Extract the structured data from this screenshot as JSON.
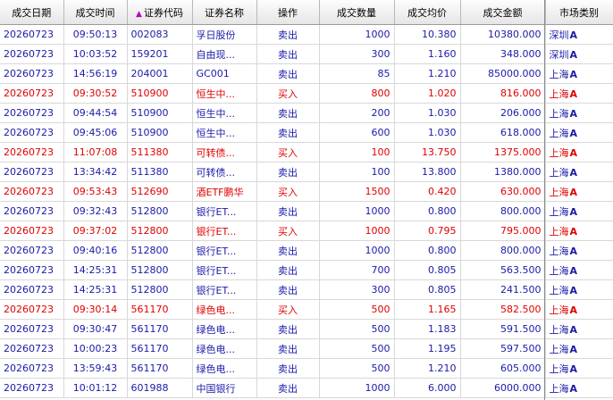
{
  "columns": [
    "成交日期",
    "成交时间",
    "证券代码",
    "证券名称",
    "操作",
    "成交数量",
    "成交均价",
    "成交金额",
    "市场类别"
  ],
  "sorted_column": "证券代码",
  "colors": {
    "sell": "#1a1aa8",
    "buy": "#e00000",
    "sort_arrow": "#c000c0"
  },
  "rows": [
    {
      "date": "20260723",
      "time": "09:50:13",
      "code": "002083",
      "name": "孚日股份",
      "op": "卖出",
      "qty": "1000",
      "price": "10.380",
      "amount": "10380.000",
      "market": "深圳",
      "mark": "A",
      "type": "sell"
    },
    {
      "date": "20260723",
      "time": "10:03:52",
      "code": "159201",
      "name": "自由现...",
      "op": "卖出",
      "qty": "300",
      "price": "1.160",
      "amount": "348.000",
      "market": "深圳",
      "mark": "A",
      "type": "sell"
    },
    {
      "date": "20260723",
      "time": "14:56:19",
      "code": "204001",
      "name": "GC001",
      "op": "卖出",
      "qty": "85",
      "price": "1.210",
      "amount": "85000.000",
      "market": "上海",
      "mark": "A",
      "type": "sell"
    },
    {
      "date": "20260723",
      "time": "09:30:52",
      "code": "510900",
      "name": "恒生中...",
      "op": "买入",
      "qty": "800",
      "price": "1.020",
      "amount": "816.000",
      "market": "上海",
      "mark": "A",
      "type": "buy"
    },
    {
      "date": "20260723",
      "time": "09:44:54",
      "code": "510900",
      "name": "恒生中...",
      "op": "卖出",
      "qty": "200",
      "price": "1.030",
      "amount": "206.000",
      "market": "上海",
      "mark": "A",
      "type": "sell"
    },
    {
      "date": "20260723",
      "time": "09:45:06",
      "code": "510900",
      "name": "恒生中...",
      "op": "卖出",
      "qty": "600",
      "price": "1.030",
      "amount": "618.000",
      "market": "上海",
      "mark": "A",
      "type": "sell"
    },
    {
      "date": "20260723",
      "time": "11:07:08",
      "code": "511380",
      "name": "可转债...",
      "op": "买入",
      "qty": "100",
      "price": "13.750",
      "amount": "1375.000",
      "market": "上海",
      "mark": "A",
      "type": "buy"
    },
    {
      "date": "20260723",
      "time": "13:34:42",
      "code": "511380",
      "name": "可转债...",
      "op": "卖出",
      "qty": "100",
      "price": "13.800",
      "amount": "1380.000",
      "market": "上海",
      "mark": "A",
      "type": "sell"
    },
    {
      "date": "20260723",
      "time": "09:53:43",
      "code": "512690",
      "name": "酒ETF鹏华",
      "op": "买入",
      "qty": "1500",
      "price": "0.420",
      "amount": "630.000",
      "market": "上海",
      "mark": "A",
      "type": "buy"
    },
    {
      "date": "20260723",
      "time": "09:32:43",
      "code": "512800",
      "name": "银行ET...",
      "op": "卖出",
      "qty": "1000",
      "price": "0.800",
      "amount": "800.000",
      "market": "上海",
      "mark": "A",
      "type": "sell"
    },
    {
      "date": "20260723",
      "time": "09:37:02",
      "code": "512800",
      "name": "银行ET...",
      "op": "买入",
      "qty": "1000",
      "price": "0.795",
      "amount": "795.000",
      "market": "上海",
      "mark": "A",
      "type": "buy"
    },
    {
      "date": "20260723",
      "time": "09:40:16",
      "code": "512800",
      "name": "银行ET...",
      "op": "卖出",
      "qty": "1000",
      "price": "0.800",
      "amount": "800.000",
      "market": "上海",
      "mark": "A",
      "type": "sell"
    },
    {
      "date": "20260723",
      "time": "14:25:31",
      "code": "512800",
      "name": "银行ET...",
      "op": "卖出",
      "qty": "700",
      "price": "0.805",
      "amount": "563.500",
      "market": "上海",
      "mark": "A",
      "type": "sell"
    },
    {
      "date": "20260723",
      "time": "14:25:31",
      "code": "512800",
      "name": "银行ET...",
      "op": "卖出",
      "qty": "300",
      "price": "0.805",
      "amount": "241.500",
      "market": "上海",
      "mark": "A",
      "type": "sell"
    },
    {
      "date": "20260723",
      "time": "09:30:14",
      "code": "561170",
      "name": "绿色电...",
      "op": "买入",
      "qty": "500",
      "price": "1.165",
      "amount": "582.500",
      "market": "上海",
      "mark": "A",
      "type": "buy"
    },
    {
      "date": "20260723",
      "time": "09:30:47",
      "code": "561170",
      "name": "绿色电...",
      "op": "卖出",
      "qty": "500",
      "price": "1.183",
      "amount": "591.500",
      "market": "上海",
      "mark": "A",
      "type": "sell"
    },
    {
      "date": "20260723",
      "time": "10:00:23",
      "code": "561170",
      "name": "绿色电...",
      "op": "卖出",
      "qty": "500",
      "price": "1.195",
      "amount": "597.500",
      "market": "上海",
      "mark": "A",
      "type": "sell"
    },
    {
      "date": "20260723",
      "time": "13:59:43",
      "code": "561170",
      "name": "绿色电...",
      "op": "卖出",
      "qty": "500",
      "price": "1.210",
      "amount": "605.000",
      "market": "上海",
      "mark": "A",
      "type": "sell"
    },
    {
      "date": "20260723",
      "time": "10:01:12",
      "code": "601988",
      "name": "中国银行",
      "op": "卖出",
      "qty": "1000",
      "price": "6.000",
      "amount": "6000.000",
      "market": "上海",
      "mark": "A",
      "type": "sell"
    }
  ]
}
